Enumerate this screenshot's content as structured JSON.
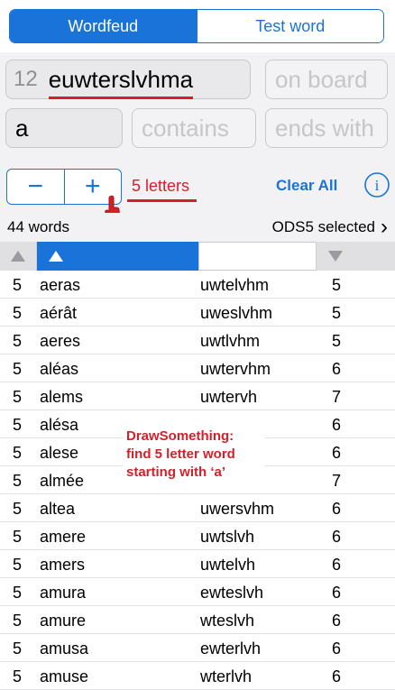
{
  "segmented": {
    "tab1": "Wordfeud",
    "tab2": "Test word"
  },
  "search": {
    "letter_count": "12",
    "letters": "euwterslvhma",
    "on_board_placeholder": "on board",
    "starts_with": "a",
    "contains_placeholder": "contains",
    "ends_with_placeholder": "ends with"
  },
  "controls": {
    "minus": "−",
    "plus": "+",
    "length_label": "5 letters",
    "clear_all": "Clear All",
    "info": "i"
  },
  "status": {
    "count": "44 words",
    "dictionary": "ODS5 selected",
    "chevron": "›"
  },
  "annotation": {
    "line1": "DrawSomething:",
    "line2": "find 5 letter word",
    "line3": "starting with ‘a’"
  },
  "rows": [
    {
      "len": "5",
      "word": "aeras",
      "remaining": "uwtelvhm",
      "score": "5"
    },
    {
      "len": "5",
      "word": "aérât",
      "remaining": "uweslvhm",
      "score": "5"
    },
    {
      "len": "5",
      "word": "aeres",
      "remaining": "uwtlvhm",
      "score": "5"
    },
    {
      "len": "5",
      "word": "aléas",
      "remaining": "uwtervhm",
      "score": "6"
    },
    {
      "len": "5",
      "word": "alems",
      "remaining": "uwtervh",
      "score": "7"
    },
    {
      "len": "5",
      "word": "alésa",
      "remaining": "",
      "score": "6"
    },
    {
      "len": "5",
      "word": "alese",
      "remaining": "",
      "score": "6"
    },
    {
      "len": "5",
      "word": "almée",
      "remaining": "",
      "score": "7"
    },
    {
      "len": "5",
      "word": "altea",
      "remaining": "uwersvhm",
      "score": "6"
    },
    {
      "len": "5",
      "word": "amere",
      "remaining": "uwtslvh",
      "score": "6"
    },
    {
      "len": "5",
      "word": "amers",
      "remaining": "uwtelvh",
      "score": "6"
    },
    {
      "len": "5",
      "word": "amura",
      "remaining": "ewteslvh",
      "score": "6"
    },
    {
      "len": "5",
      "word": "amure",
      "remaining": "wteslvh",
      "score": "6"
    },
    {
      "len": "5",
      "word": "amusa",
      "remaining": "ewterlvh",
      "score": "6"
    },
    {
      "len": "5",
      "word": "amuse",
      "remaining": "wterlvh",
      "score": "6"
    }
  ],
  "colors": {
    "accent": "#1a73d9",
    "highlight": "#d4202a"
  },
  "icons": {
    "sort_up": "triangle-up-icon",
    "sort_down": "triangle-down-icon",
    "info": "info-circle-icon",
    "pointer": "hand-pointer-icon"
  }
}
